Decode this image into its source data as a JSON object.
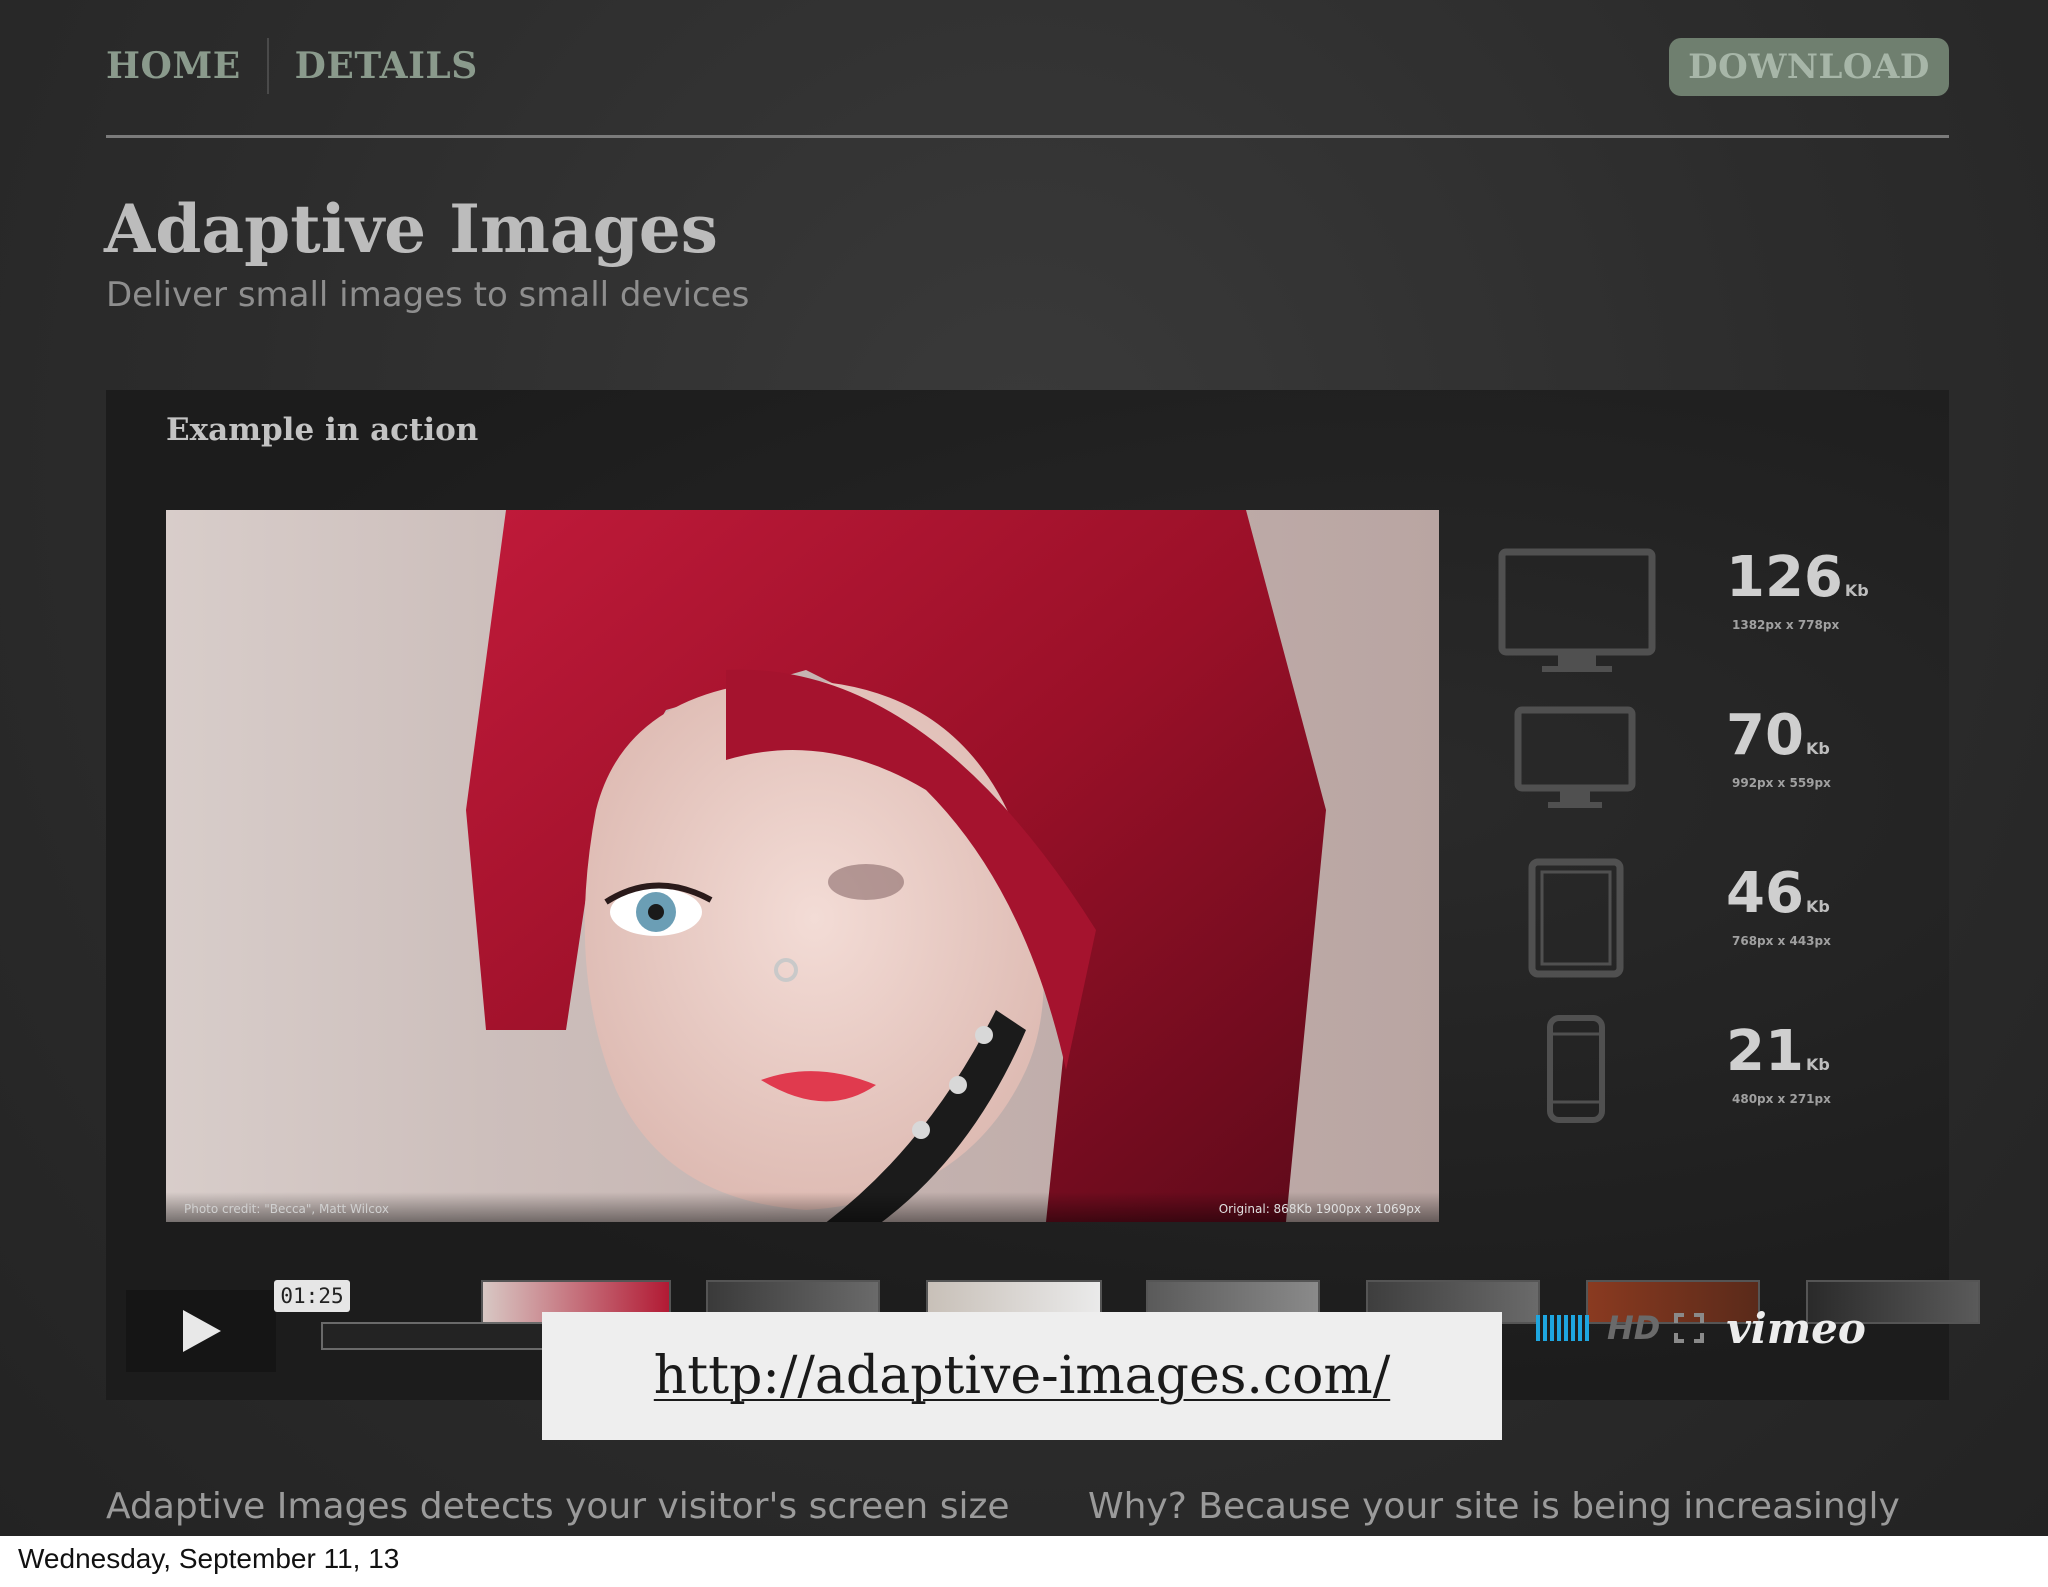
{
  "nav": {
    "home": "HOME",
    "details": "DETAILS",
    "download": "DOWNLOAD"
  },
  "header": {
    "title": "Adaptive Images",
    "subtitle": "Deliver small images to small devices"
  },
  "example": {
    "heading": "Example in action",
    "photo_credit": "Photo credit: \"Becca\", Matt Wilcox",
    "photo_original": "Original: 868Kb 1900px x 1069px",
    "devices": [
      {
        "icon": "desktop-monitor-icon",
        "size": "126",
        "unit": "Kb",
        "dims": "1382px x 778px"
      },
      {
        "icon": "laptop-monitor-icon",
        "size": "70",
        "unit": "Kb",
        "dims": "992px x 559px"
      },
      {
        "icon": "tablet-icon",
        "size": "46",
        "unit": "Kb",
        "dims": "768px x 443px"
      },
      {
        "icon": "phone-icon",
        "size": "21",
        "unit": "Kb",
        "dims": "480px x 271px"
      }
    ]
  },
  "video": {
    "time": "01:25",
    "hd": "HD",
    "brand": "vimeo"
  },
  "url": "http://adaptive-images.com/",
  "body": {
    "col1": "Adaptive Images detects your visitor's screen size",
    "col2": "Why? Because your site is being increasingly"
  },
  "footer": {
    "date": "Wednesday, September 11, 13"
  },
  "colors": {
    "accent": "#6f7f6f",
    "volume": "#1ea6e0",
    "background": "#2c2c2c"
  }
}
